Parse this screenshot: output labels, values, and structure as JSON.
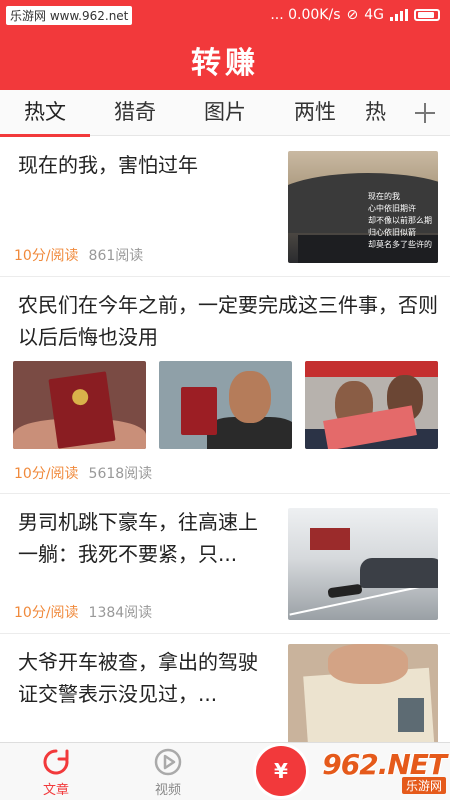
{
  "status": {
    "watermark": "乐游网 www.962.net",
    "speed": "... 0.00K/s",
    "network": "4G"
  },
  "header": {
    "title": "转赚"
  },
  "tabs": [
    {
      "label": "热文",
      "active": true
    },
    {
      "label": "猎奇",
      "active": false
    },
    {
      "label": "图片",
      "active": false
    },
    {
      "label": "两性",
      "active": false
    },
    {
      "label": "热",
      "active": false
    }
  ],
  "feed": [
    {
      "title": "现在的我，害怕过年",
      "tag": "10分/阅读",
      "reads": "861阅读",
      "image_text": "现在的我\n心中依旧期许\n却不像以前那么期\n归心依旧似箭\n却莫名多了些许的"
    },
    {
      "title": "农民们在今年之前，一定要完成这三件事，否则以后后悔也没用",
      "tag": "10分/阅读",
      "reads": "5618阅读"
    },
    {
      "title": "男司机跳下豪车，往高速上一躺：我死不要紧，只...",
      "tag": "10分/阅读",
      "reads": "1384阅读"
    },
    {
      "title": "大爷开车被查，拿出的驾驶证交警表示没见过，..."
    }
  ],
  "bottom_nav": {
    "article": "文章",
    "video": "视频",
    "center_icon": "¥"
  },
  "watermark_962": {
    "big": "962.NET",
    "small": "乐游网"
  },
  "colors": {
    "brand_red": "#f2393b",
    "tag_orange": "#f08a3c"
  }
}
